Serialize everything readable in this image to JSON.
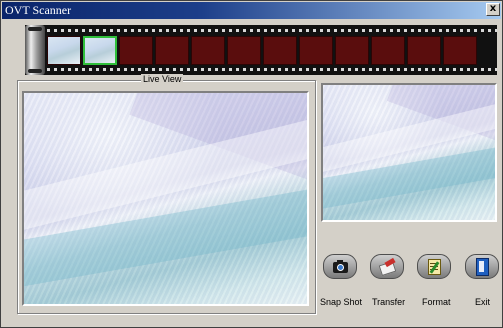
{
  "window": {
    "title": "OVT Scanner",
    "close_label": "x"
  },
  "filmstrip": {
    "frame_count": 12,
    "thumbnail_count": 2,
    "selected_index": 1
  },
  "live_view": {
    "label": "Live View"
  },
  "toolbar": {
    "snapshot_label": "Snap Shot",
    "transfer_label": "Transfer",
    "format_label": "Format",
    "exit_label": "Exit"
  },
  "icons": {
    "snapshot": "camera-icon",
    "transfer": "transfer-icon",
    "format": "format-icon",
    "exit": "exit-door-icon"
  },
  "colors": {
    "titlebar_start": "#0a246a",
    "titlebar_end": "#a6caf0",
    "window_bg": "#d4d0c8",
    "film_frame": "#5a0d0d",
    "selected_frame": "#2fbf3a"
  }
}
